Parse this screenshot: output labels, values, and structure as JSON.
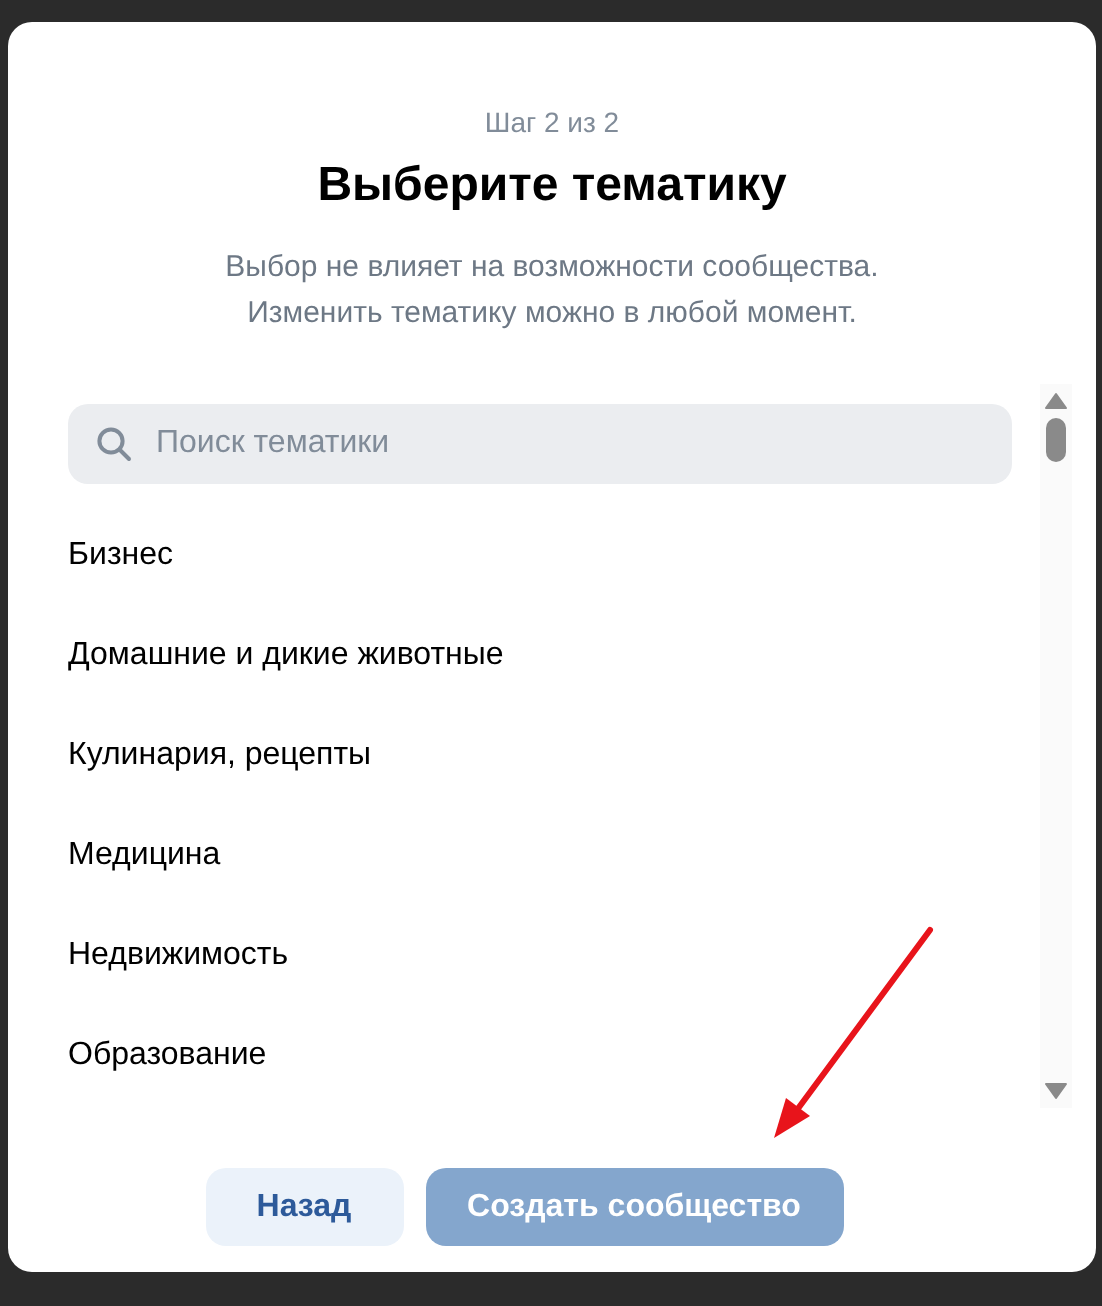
{
  "dialog": {
    "step": "Шаг 2 из 2",
    "title": "Выберите тематику",
    "subtitle": [
      "Выбор не влияет на возможности сообщества.",
      "Изменить тематику можно в любой момент."
    ]
  },
  "search": {
    "placeholder": "Поиск тематики"
  },
  "topics": [
    {
      "label": "Бизнес"
    },
    {
      "label": "Домашние и дикие животные"
    },
    {
      "label": "Кулинария, рецепты"
    },
    {
      "label": "Медицина"
    },
    {
      "label": "Недвижимость"
    },
    {
      "label": "Образование"
    }
  ],
  "buttons": [
    {
      "label": "Назад",
      "kind": "secondary",
      "disabled": false
    },
    {
      "label": "Создать сообщество",
      "kind": "primary",
      "disabled": true
    }
  ]
}
